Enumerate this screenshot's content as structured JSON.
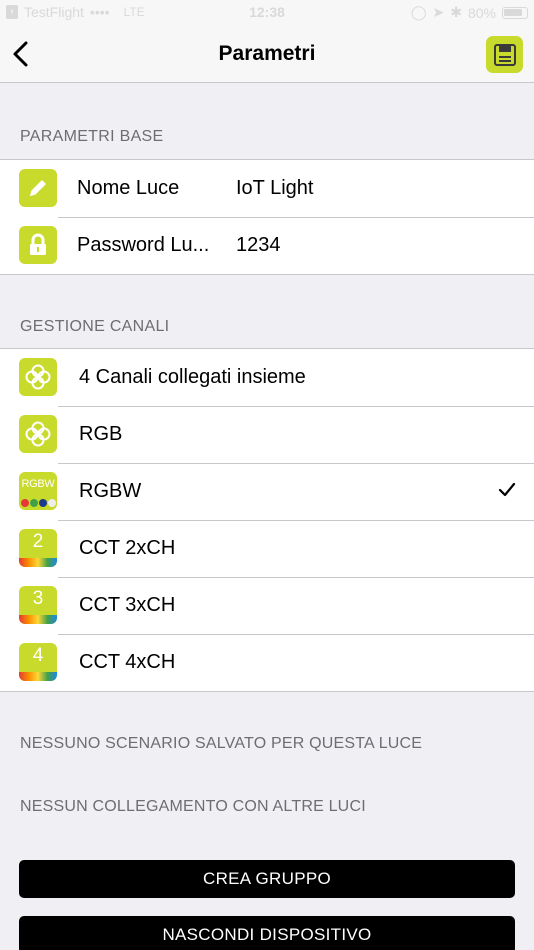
{
  "status_bar": {
    "carrier": "TestFlight",
    "signal": "••••",
    "network": "LTE",
    "time": "12:38",
    "battery": "80%"
  },
  "nav": {
    "title": "Parametri",
    "back_icon": "chevron-left-icon",
    "save_icon": "floppy-disk-icon"
  },
  "base_section": {
    "header": "PARAMETRI BASE",
    "rows": [
      {
        "label": "Nome Luce",
        "value": "IoT Light",
        "icon": "pencil-icon"
      },
      {
        "label": "Password Lu...",
        "value": "1234",
        "icon": "lock-icon"
      }
    ]
  },
  "channels_section": {
    "header": "GESTIONE CANALI",
    "rows": [
      {
        "label": "4 Canali collegati insieme",
        "icon": "channels-linked-icon",
        "selected": false
      },
      {
        "label": "RGB",
        "icon": "rgb-icon",
        "selected": false
      },
      {
        "label": "RGBW",
        "icon": "rgbw-icon",
        "icon_text": "RGBW",
        "selected": true
      },
      {
        "label": "CCT 2xCH",
        "icon": "cct-icon",
        "icon_text": "2",
        "selected": false
      },
      {
        "label": "CCT 3xCH",
        "icon": "cct-icon",
        "icon_text": "3",
        "selected": false
      },
      {
        "label": "CCT 4xCH",
        "icon": "cct-icon",
        "icon_text": "4",
        "selected": false
      }
    ]
  },
  "info": {
    "no_scenes": "NESSUNO SCENARIO SALVATO PER QUESTA LUCE",
    "no_links": "NESSUN COLLEGAMENTO CON ALTRE LUCI"
  },
  "buttons": {
    "create_group": "CREA GRUPPO",
    "hide_device": "NASCONDI DISPOSITIVO"
  },
  "colors": {
    "accent": "#c8da2b",
    "background": "#efeff4",
    "button": "#000000"
  }
}
